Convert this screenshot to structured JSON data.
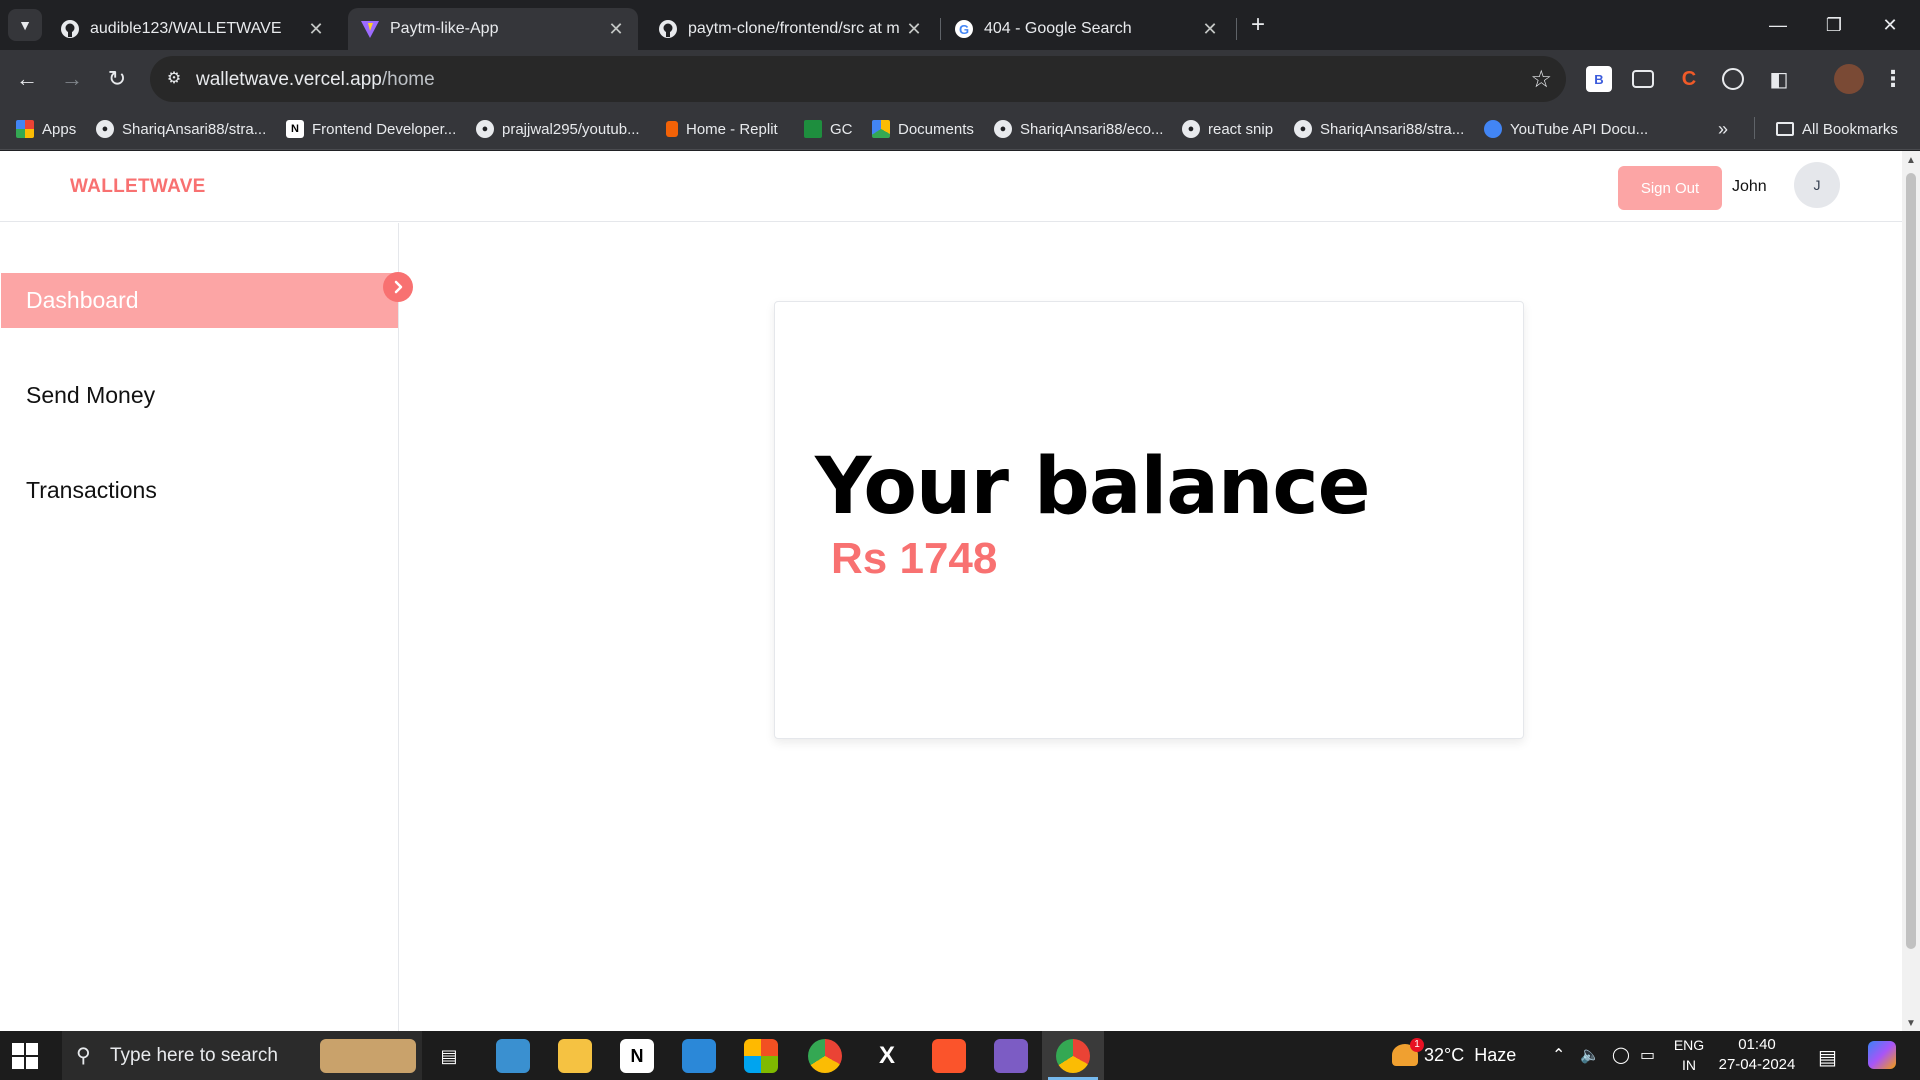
{
  "browser": {
    "tabs": [
      {
        "title": "audible123/WALLETWAVE",
        "icon": "github-icon"
      },
      {
        "title": "Paytm-like-App",
        "icon": "vite-icon"
      },
      {
        "title": "paytm-clone/frontend/src at m",
        "icon": "github-icon"
      },
      {
        "title": "404 - Google Search",
        "icon": "google-icon"
      }
    ],
    "url_host": "walletwave.vercel.app",
    "url_path": "/home",
    "bookmarks": [
      {
        "label": "Apps"
      },
      {
        "label": "ShariqAnsari88/stra..."
      },
      {
        "label": "Frontend Developer..."
      },
      {
        "label": "prajjwal295/youtub..."
      },
      {
        "label": "Home - Replit"
      },
      {
        "label": "GC"
      },
      {
        "label": "Documents"
      },
      {
        "label": "ShariqAnsari88/eco..."
      },
      {
        "label": "react snip"
      },
      {
        "label": "ShariqAnsari88/stra..."
      },
      {
        "label": "YouTube API Docu..."
      }
    ],
    "all_bookmarks": "All Bookmarks",
    "extension_b": "B",
    "extension_c": "C"
  },
  "app": {
    "brand": "WALLETWAVE",
    "sign_out": "Sign Out",
    "user_name": "John",
    "avatar_initial": "J",
    "sidebar": [
      {
        "label": "Dashboard"
      },
      {
        "label": "Send Money"
      },
      {
        "label": "Transactions"
      }
    ],
    "balance_heading": "Your balance",
    "balance_amount": "Rs 1748",
    "colors": {
      "accent": "#f87171",
      "accent_light": "#fca5a5"
    }
  },
  "taskbar": {
    "search_placeholder": "Type here to search",
    "weather": "32°C  Haze",
    "weather_badge": "1",
    "lang_top": "ENG",
    "lang_bottom": "IN",
    "time": "01:40",
    "date": "27-04-2024"
  }
}
